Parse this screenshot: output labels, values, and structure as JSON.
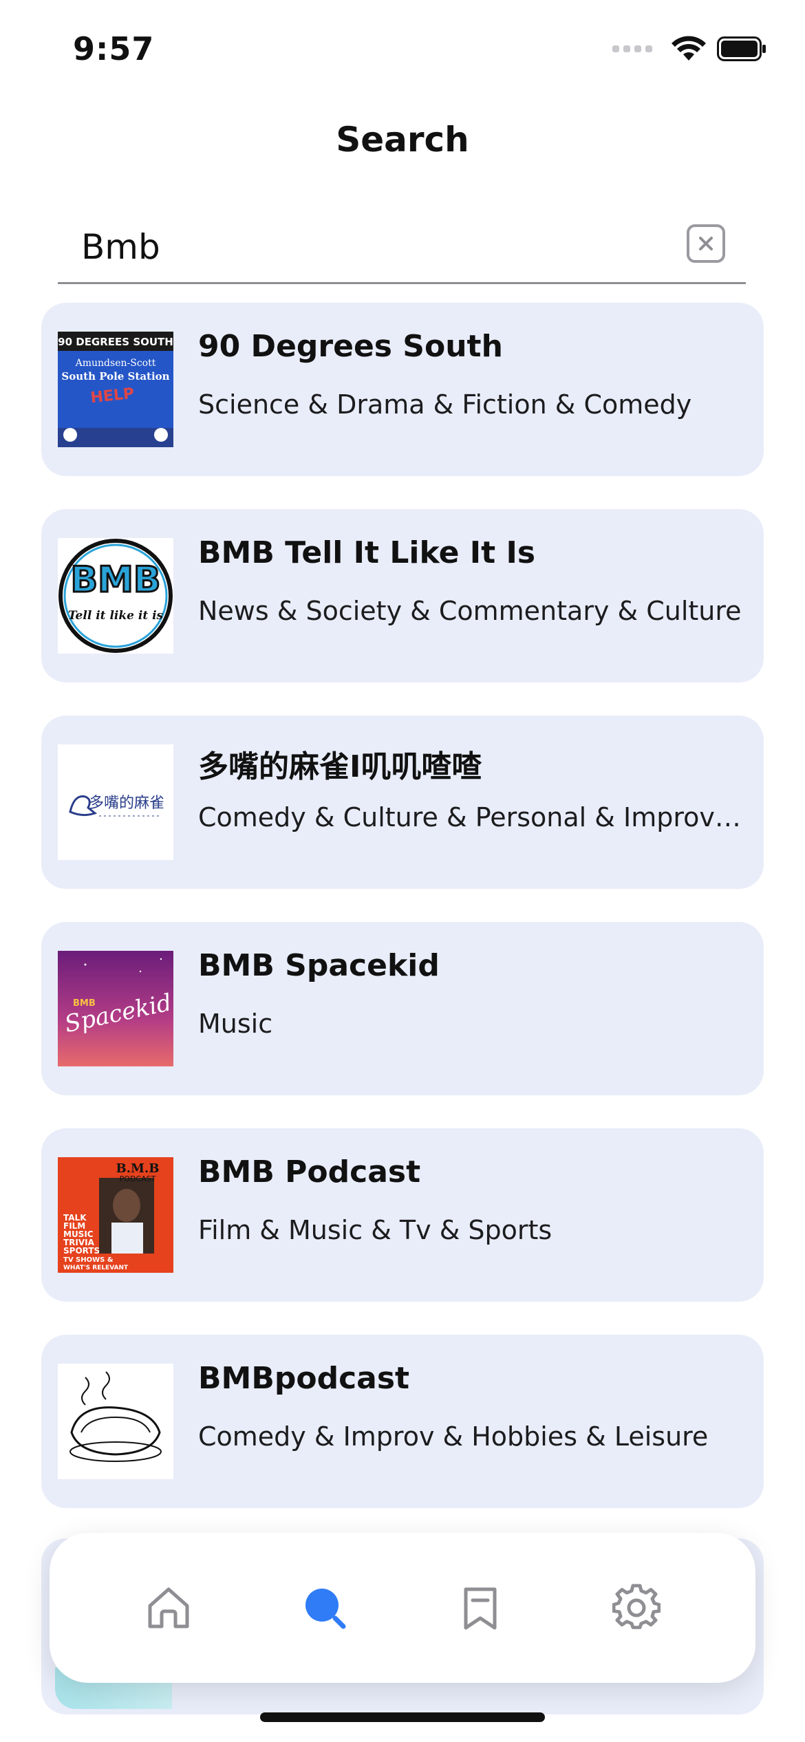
{
  "status_bar": {
    "time": "9:57"
  },
  "page": {
    "title": "Search"
  },
  "search": {
    "value": "Bmb",
    "placeholder": ""
  },
  "results": [
    {
      "title": "90 Degrees South",
      "categories": "Science & Drama & Fiction & Comedy",
      "artwork": "90-degrees-south-artwork",
      "artwork_texts": [
        "90 DEGREES SOUTH",
        "Amundsen-Scott",
        "South Pole Station",
        "HELP"
      ]
    },
    {
      "title": "BMB Tell It Like It Is",
      "categories": "News & Society & Commentary & Culture",
      "artwork": "bmb-tell-it-like-it-is-artwork",
      "artwork_texts": [
        "BMB",
        "Tell it like it is"
      ]
    },
    {
      "title": "多嘴的麻雀I叽叽喳喳",
      "categories": "Comedy & Culture & Personal & Improv & Hobbies",
      "artwork": "sparrow-artwork",
      "artwork_texts": [
        "多嘴的麻雀"
      ]
    },
    {
      "title": "BMB Spacekid",
      "categories": "Music",
      "artwork": "bmb-spacekid-artwork",
      "artwork_texts": [
        "BMB",
        "Spacekid"
      ]
    },
    {
      "title": "BMB Podcast",
      "categories": "Film & Music & Tv & Sports",
      "artwork": "bmb-podcast-artwork",
      "artwork_texts": [
        "B.M.B",
        "PODCAST",
        "TALK",
        "FILM",
        "MUSIC",
        "TRIVIA",
        "SPORTS",
        "TV SHOWS &",
        "WHAT'S RELEVANT"
      ]
    },
    {
      "title": "BMBpodcast",
      "categories": "Comedy & Improv & Hobbies & Leisure",
      "artwork": "bmbpodcast-sketch-artwork",
      "artwork_texts": []
    }
  ],
  "tab_bar": {
    "items": [
      {
        "name": "home",
        "icon": "home-icon",
        "active": false
      },
      {
        "name": "search",
        "icon": "search-icon",
        "active": true
      },
      {
        "name": "bookmarks",
        "icon": "bookmark-icon",
        "active": false
      },
      {
        "name": "settings",
        "icon": "gear-icon",
        "active": false
      }
    ],
    "active_color": "#2f7cf6",
    "inactive_color": "#8e8e93"
  },
  "colors": {
    "card_background": "#e9edf9",
    "background": "#ffffff"
  }
}
